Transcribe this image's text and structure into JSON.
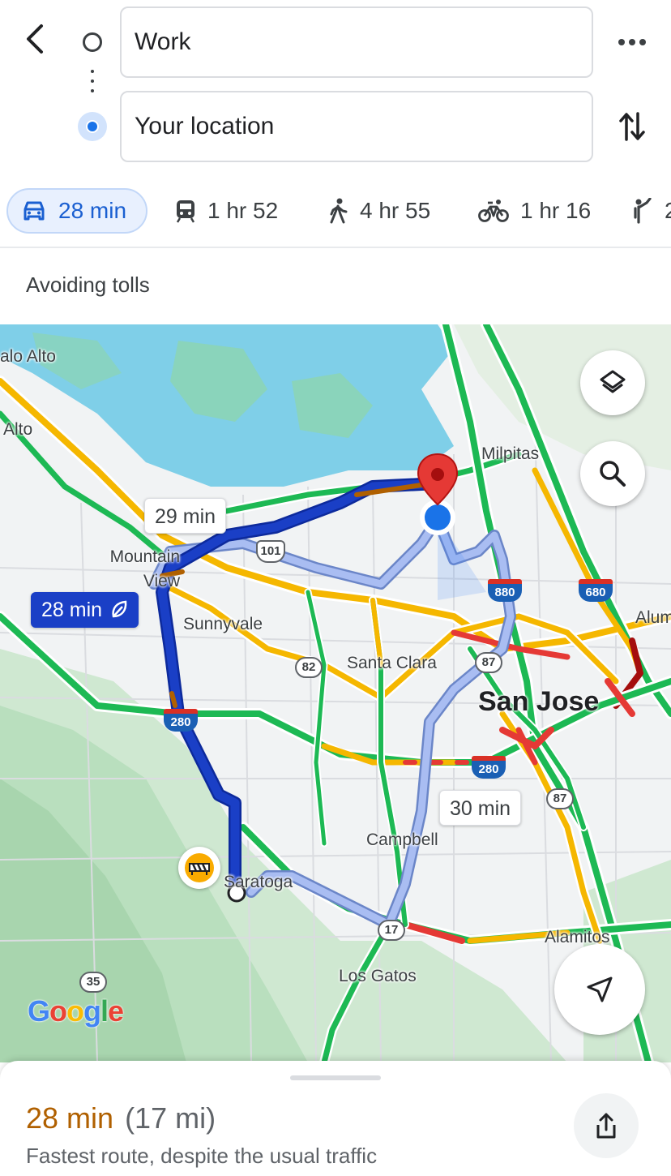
{
  "header": {
    "origin_value": "Work",
    "destination_value": "Your location",
    "icons": {
      "back": "back-arrow-icon",
      "more": "more-horizontal-icon",
      "swap": "swap-vertical-icon"
    }
  },
  "modes": [
    {
      "mode": "drive",
      "label": "28 min",
      "icon": "car-icon",
      "selected": true
    },
    {
      "mode": "transit",
      "label": "1 hr 52",
      "icon": "train-icon"
    },
    {
      "mode": "walk",
      "label": "4 hr 55",
      "icon": "walk-icon"
    },
    {
      "mode": "bike",
      "label": "1 hr 16",
      "icon": "bike-icon"
    },
    {
      "mode": "ride",
      "label": "2",
      "icon": "hail-ride-icon"
    }
  ],
  "options_text": "Avoiding tolls",
  "map": {
    "places": [
      "alo Alto",
      "Alto",
      "Milpitas",
      "Mountain View",
      "Sunnyvale",
      "Santa Clara",
      "San Jose",
      "Alum",
      "Campbell",
      "Saratoga",
      "Los Gatos",
      "Alamitos"
    ],
    "shields": [
      "101",
      "82",
      "87",
      "280",
      "880",
      "680",
      "87",
      "17",
      "35",
      "280"
    ],
    "routes": [
      {
        "label": "28 min",
        "selected": true,
        "eco": true,
        "color": "#1a3fc6"
      },
      {
        "label": "29 min",
        "selected": false
      },
      {
        "label": "30 min",
        "selected": false
      }
    ],
    "logo": "Google",
    "traffic_colors": {
      "free": "#1db954",
      "slow": "#f5b700",
      "heavy": "#e53935",
      "jam": "#a50e0e"
    }
  },
  "summary": {
    "duration": "28 min",
    "distance": "(17 mi)",
    "description": "Fastest route, despite the usual traffic",
    "duration_color": "#b06000"
  }
}
